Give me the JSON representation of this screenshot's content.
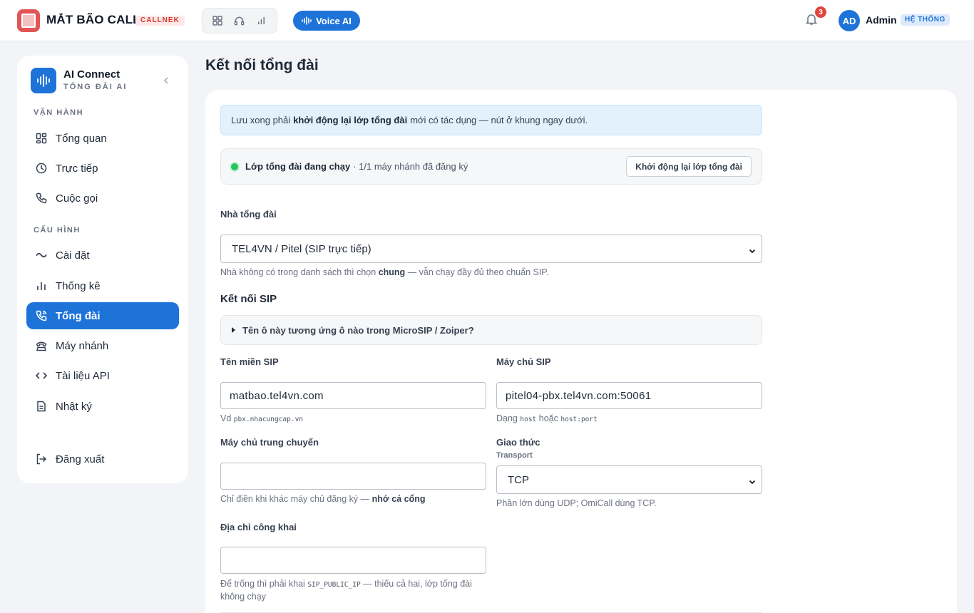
{
  "colors": {
    "accent": "#1e73d8",
    "brand_red": "#d6392f",
    "status_green": "#22c55e"
  },
  "header": {
    "brand": "MẮT BÃO CALL",
    "brand_badge": "CALLNEK",
    "voice_button": "Voice AI",
    "notification_count": "3",
    "avatar_initials": "AD",
    "user_name": "Admin",
    "user_role": "HỆ THỐNG",
    "icons": [
      "grid-icon",
      "headset-icon",
      "bar-chart-icon"
    ]
  },
  "sidebar": {
    "app_name": "AI Connect",
    "app_sub": "TỔNG ĐÀI AI",
    "section_ops": "VẬN HÀNH",
    "section_config": "CẤU HÌNH",
    "items": [
      {
        "label": "Tổng quan",
        "icon": "dashboard-icon"
      },
      {
        "label": "Trực tiếp",
        "icon": "clock-icon"
      },
      {
        "label": "Cuộc gọi",
        "icon": "phone-icon"
      },
      {
        "label": "Cài đặt",
        "icon": "settings-icon"
      },
      {
        "label": "Thống kê",
        "icon": "stats-icon"
      },
      {
        "label": "Tổng đài",
        "icon": "phone-call-icon",
        "active": true
      },
      {
        "label": "Máy nhánh",
        "icon": "handset-icon"
      },
      {
        "label": "Tài liệu API",
        "icon": "code-icon"
      },
      {
        "label": "Nhật ký",
        "icon": "log-icon"
      }
    ],
    "logout": "Đăng xuất"
  },
  "main": {
    "title": "Kết nối tổng đài",
    "notice": {
      "prefix": "Lưu xong phải",
      "bold": "khởi động lại lớp tổng đài",
      "suffix": "mới có tác dụng — nút ở khung ngay dưới."
    },
    "status": {
      "main": "Lớp tổng đài đang chạy",
      "sub": "· 1/1 máy nhánh đã đăng ký",
      "restart_button": "Khởi động lại lớp tổng đài"
    },
    "provider": {
      "label": "Nhà tổng đài",
      "value": "TEL4VN / Pitel (SIP trực tiếp)",
      "hint_prefix": "Nhà không có trong danh sách thì chọn",
      "hint_bold": "chung",
      "hint_suffix": "— vẫn chạy đầy đủ theo chuẩn SIP."
    },
    "sip_section": "Kết nối SIP",
    "details_summary": "Tên ô này tương ứng ô nào trong MicroSIP / Zoiper?",
    "sip_domain": {
      "label": "Tên miền SIP",
      "value": "matbao.tel4vn.com",
      "hint_prefix": "Vd",
      "hint_code": "pbx.nhacungcap.vn"
    },
    "sip_server": {
      "label": "Máy chủ SIP",
      "value": "pitel04-pbx.tel4vn.com:50061",
      "hint_prefix": "Dạng",
      "hint_code1": "host",
      "hint_mid": "hoặc",
      "hint_code2": "host:port"
    },
    "proxy": {
      "label": "Máy chủ trung chuyển",
      "value": "",
      "hint_prefix": "Chỉ điền khi khác máy chủ đăng ký —",
      "hint_bold": "nhớ cả cổng"
    },
    "transport": {
      "label": "Giao thức",
      "sublabel": "Transport",
      "value": "TCP",
      "hint": "Phần lớn dùng UDP; OmiCall dùng TCP."
    },
    "public_ip": {
      "label": "Địa chỉ công khai",
      "value": "",
      "hint_prefix": "Để trống thì phải khai",
      "hint_code": "SIP_PUBLIC_IP",
      "hint_suffix": "— thiếu cả hai, lớp tổng đài không chạy"
    }
  }
}
